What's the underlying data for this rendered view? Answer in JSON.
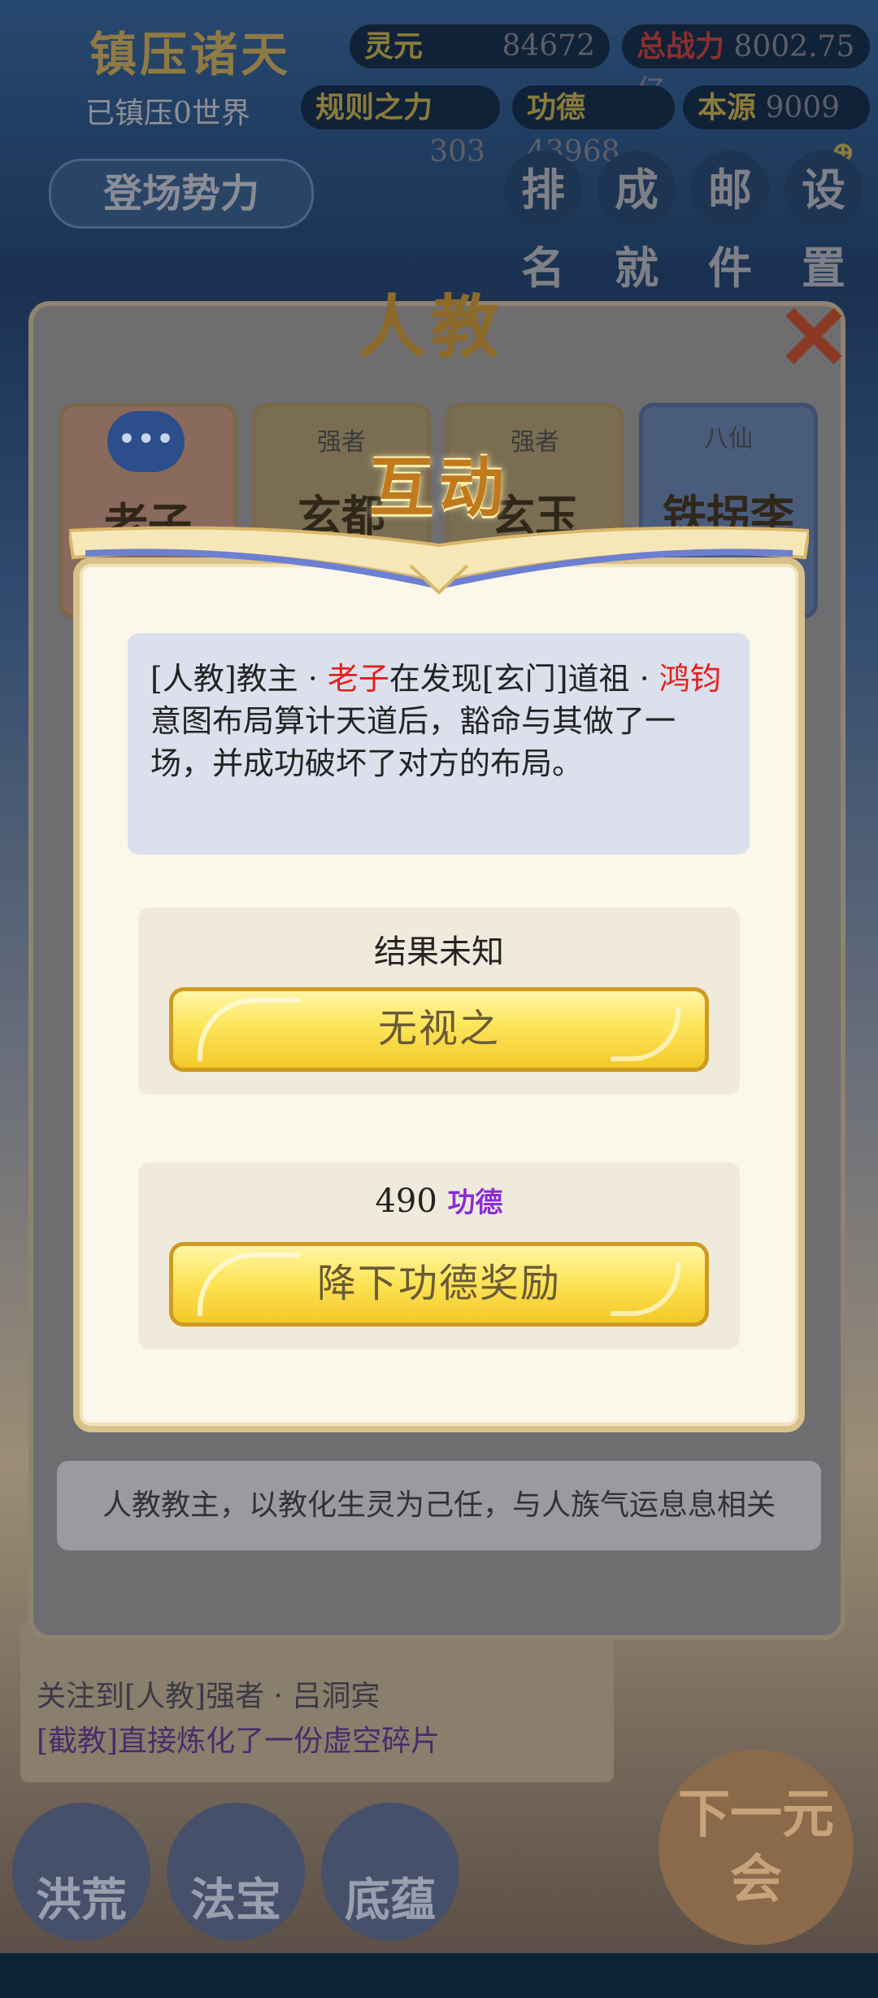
{
  "header": {
    "game_title": "镇压诸天",
    "world_status": "已镇压0世界",
    "spirit": {
      "label": "灵元",
      "value": "84672"
    },
    "power": {
      "label": "总战力",
      "value": "8002.75亿"
    },
    "rule": {
      "label": "规则之力",
      "value": "303"
    },
    "merit": {
      "label": "功德",
      "value": "43968"
    },
    "origin": {
      "label": "本源",
      "value": "9009"
    },
    "deploy_button": "登场势力",
    "menu": [
      "排名",
      "成就",
      "邮件",
      "设置"
    ]
  },
  "panel": {
    "title": "人教",
    "cards": [
      {
        "tag": "",
        "name": "老子"
      },
      {
        "tag": "强者",
        "name": "玄都"
      },
      {
        "tag": "强者",
        "name": "玄玉"
      },
      {
        "tag": "八仙",
        "name": "铁拐李"
      }
    ],
    "description": "人教教主，以教化生灵为己任，与人族气运息息相关"
  },
  "log": {
    "lines": [
      "关注到[人教]强者 · 吕洞宾",
      "[截教]直接炼化了一份虚空碎片"
    ]
  },
  "bottom_nav": [
    "洪荒",
    "法宝",
    "底蕴",
    "下一元会"
  ],
  "dialog": {
    "title": "互动",
    "message": {
      "part1": "[人教]教主 · ",
      "name1": "老子",
      "part2": "在发现[玄门]道祖 · ",
      "name2": "鸿钧",
      "part3": "意图布局算计天道后，豁命与其做了一场，并成功破坏了对方的布局。"
    },
    "options": [
      {
        "label": "结果未知",
        "button": "无视之"
      },
      {
        "cost_value": "490",
        "cost_unit": "功德",
        "button": "降下功德奖励"
      }
    ]
  },
  "colors": {
    "highlight_name": "#e51f1f",
    "merit_text": "#8a2bd6",
    "button_gold": "#fde55a",
    "dialog_bg": "#fbf7ea"
  }
}
